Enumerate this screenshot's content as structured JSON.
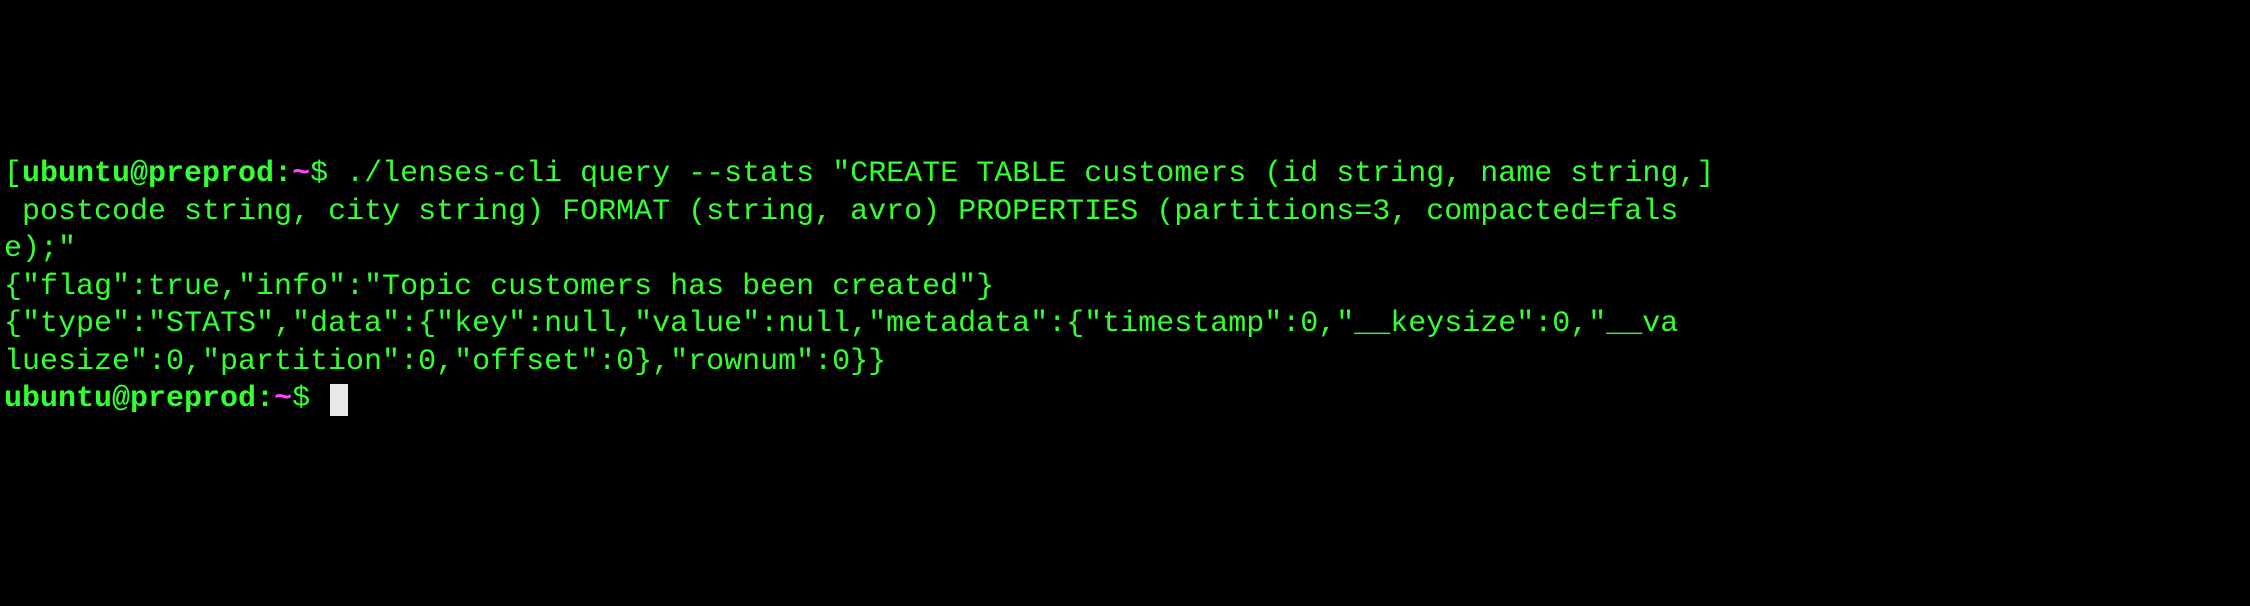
{
  "terminal": {
    "prompt1": {
      "bracket_open": "[",
      "user_host": "ubuntu@preprod",
      "colon": ":",
      "path": "~",
      "dollar": "$",
      "bracket_close": "]"
    },
    "command_line1": " ./lenses-cli query --stats \"CREATE TABLE customers (id string, name string,",
    "command_line2": " postcode string, city string) FORMAT (string, avro) PROPERTIES (partitions=3, compacted=fals",
    "command_line3": "e);\"",
    "output_line1": "{\"flag\":true,\"info\":\"Topic customers has been created\"}",
    "output_line2": "{\"type\":\"STATS\",\"data\":{\"key\":null,\"value\":null,\"metadata\":{\"timestamp\":0,\"__keysize\":0,\"__va",
    "output_line3": "luesize\":0,\"partition\":0,\"offset\":0},\"rownum\":0}}",
    "prompt2": {
      "user_host": "ubuntu@preprod",
      "colon": ":",
      "path": "~",
      "dollar": "$"
    }
  }
}
